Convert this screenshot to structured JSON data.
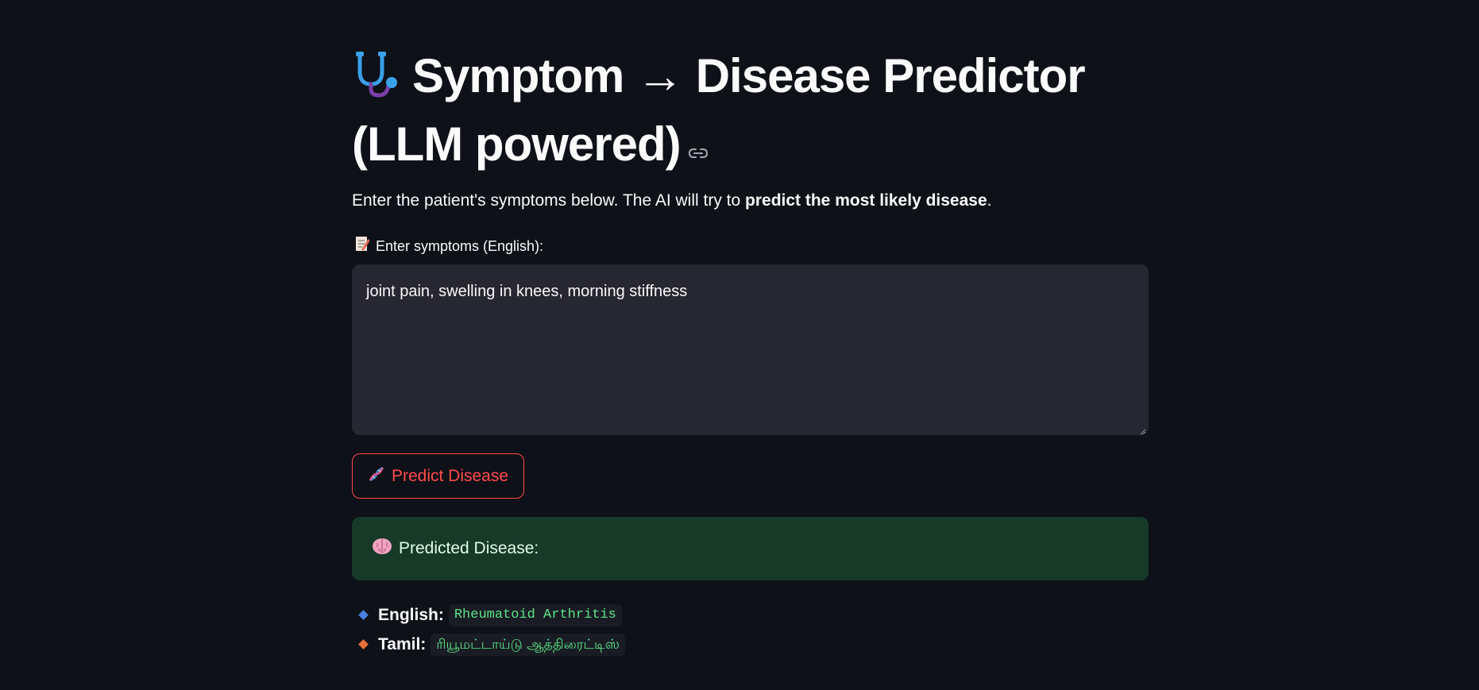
{
  "header": {
    "title_line": "Symptom → Disease Predictor (LLM powered)",
    "title_icon": "stethoscope-icon",
    "anchor_icon": "link-icon"
  },
  "intro": {
    "text_before": "Enter the patient's symptoms below. The AI will try to ",
    "text_bold": "predict the most likely disease",
    "text_after": "."
  },
  "symptoms_input": {
    "label": "Enter symptoms (English):",
    "label_icon": "memo-icon",
    "value": "joint pain, swelling in knees, morning stiffness"
  },
  "predict_button": {
    "label": "Predict Disease",
    "icon": "dna-icon",
    "color": "#ff4b4b"
  },
  "result": {
    "heading": "Predicted Disease:",
    "heading_icon": "brain-icon",
    "background": "#173928",
    "items": [
      {
        "key": "English:",
        "value": "Rheumatoid Arthritis",
        "bullet_color": "#4a7fe0"
      },
      {
        "key": "Tamil:",
        "value": "ரியூமட்டாய்டு ஆத்திரைட்டிஸ்",
        "bullet_color": "#e8703a"
      }
    ]
  }
}
